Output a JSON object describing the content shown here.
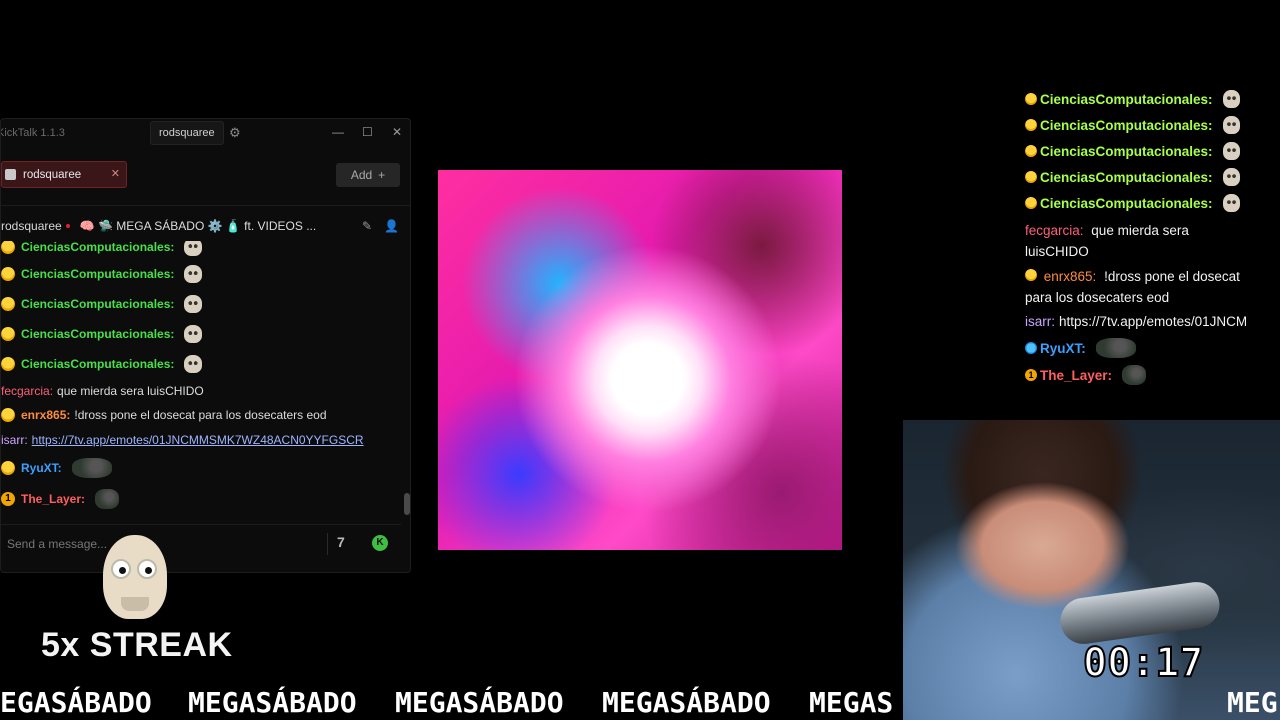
{
  "app": {
    "name": "KickTalk 1.1.3",
    "user_menu": "rodsquaree"
  },
  "tabs": [
    {
      "label": "rodsquaree"
    }
  ],
  "add_button": {
    "label": "Add"
  },
  "channel": {
    "name": "rodsquaree",
    "stream_title": "🧠 🛸 MEGA SÁBADO ⚙️ 🧴 ft. VIDEOS ..."
  },
  "chat": {
    "messages": [
      {
        "user": "CienciasComputacionales:",
        "color": "#48e048",
        "badge": "laugh",
        "emote": "skull-emote",
        "text": ""
      },
      {
        "user": "CienciasComputacionales:",
        "color": "#48e048",
        "badge": "laugh",
        "emote": "skull-emote",
        "text": ""
      },
      {
        "user": "CienciasComputacionales:",
        "color": "#48e048",
        "badge": "laugh",
        "emote": "skull-emote",
        "text": ""
      },
      {
        "user": "CienciasComputacionales:",
        "color": "#48e048",
        "badge": "laugh",
        "emote": "skull-emote",
        "text": ""
      },
      {
        "user": "CienciasComputacionales:",
        "color": "#48e048",
        "badge": "laugh",
        "emote": "skull-emote",
        "text": ""
      },
      {
        "user": "fecgarcia:",
        "color": "#ff5f7a",
        "badge": "",
        "emote": "",
        "text": "que mierda sera luisCHIDO"
      },
      {
        "user": "enrx865:",
        "color": "#ff8c3a",
        "badge": "laugh",
        "emote": "",
        "text": "!dross pone el dosecat para los dosecaters eod"
      },
      {
        "user": "isarr:",
        "color": "#c9a6ff",
        "badge": "",
        "emote": "",
        "text": "https://7tv.app/emotes/01JNCMMSMK7WZ48ACN0YYFGSCR"
      },
      {
        "user": "RyuXT:",
        "color": "#3aa0ff",
        "badge": "laugh",
        "emote": "frog-emote",
        "text": ""
      },
      {
        "user": "The_Layer:",
        "color": "#ff5f5f",
        "badge": "one",
        "emote": "frog-emote",
        "text": ""
      }
    ],
    "input_placeholder": "Send a message..."
  },
  "overlay_chat": {
    "messages": [
      {
        "user": "CienciasComputacionales:",
        "color": "#a6ff4a",
        "text": ""
      },
      {
        "user": "CienciasComputacionales:",
        "color": "#a6ff4a",
        "text": ""
      },
      {
        "user": "CienciasComputacionales:",
        "color": "#a6ff4a",
        "text": ""
      },
      {
        "user": "CienciasComputacionales:",
        "color": "#a6ff4a",
        "text": ""
      },
      {
        "user": "CienciasComputacionales:",
        "color": "#a6ff4a",
        "text": ""
      },
      {
        "user": "fecgarcia:",
        "color": "#ff5f7a",
        "text": "que mierda sera luisCHIDO"
      },
      {
        "user": "enrx865:",
        "color": "#ff8c3a",
        "text": "!dross pone el dosecat para los dosecaters eod"
      },
      {
        "user": "isarr:",
        "color": "#c9a6ff",
        "text": "https://7tv.app/emotes/01JNCM"
      },
      {
        "user": "RyuXT:",
        "color": "#3aa0ff",
        "text": ""
      },
      {
        "user": "The_Layer:",
        "color": "#ff5f5f",
        "text": ""
      }
    ]
  },
  "streak": {
    "label": "5x STREAK"
  },
  "timer": {
    "value": "00:17"
  },
  "ticker": {
    "segments": [
      "EGASÁBADO",
      "MEGASÁBADO",
      "MEGASÁBADO",
      "MEGASÁBADO",
      "MEGAS",
      "MEG"
    ]
  }
}
